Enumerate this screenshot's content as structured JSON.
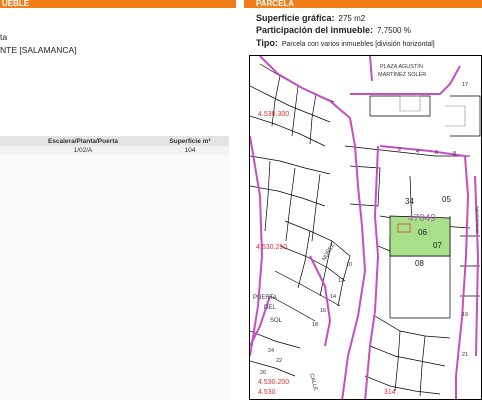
{
  "left_panel": {
    "header": "UEBLE",
    "lines": [
      "ta",
      "NTE [SALAMANCA]"
    ],
    "table": {
      "headers": [
        "Escalera/Planta/Puerta",
        "Superficie m²"
      ],
      "rows": [
        [
          "1/02/A",
          "104"
        ]
      ]
    }
  },
  "right_panel": {
    "header": "PARCELA",
    "fields": [
      {
        "label": "Superficie gráfica:",
        "value": "275 m2"
      },
      {
        "label": "Participación del inmueble:",
        "value": "7,7500 %"
      },
      {
        "label": "Tipo:",
        "value": "Parcela con varios inmuebles [división horizontal]"
      }
    ]
  },
  "map": {
    "street_labels": [
      "PLAZA AGUSTÍN",
      "MARTÍNEZ SOLER",
      "PUERTA",
      "DEL",
      "SOL",
      "CALLE",
      "NÚÑEZ"
    ],
    "parcel_id": "47049",
    "block_numbers": [
      "34",
      "05",
      "06",
      "07",
      "08"
    ],
    "coordinates": [
      "4.530.300",
      "4.530.250",
      "4.530.200",
      "4.530",
      "314"
    ],
    "house_numbers": [
      "10",
      "12",
      "14",
      "16",
      "18",
      "2",
      "4",
      "6",
      "8",
      "22",
      "24",
      "26",
      "17",
      "19",
      "21"
    ],
    "side_label": "Ayuntamiento",
    "colors": {
      "parcel_fill": "#a8e08a",
      "boundary": "#c44fc4",
      "coord": "#e03030",
      "parcel_label": "#b060b0"
    }
  }
}
